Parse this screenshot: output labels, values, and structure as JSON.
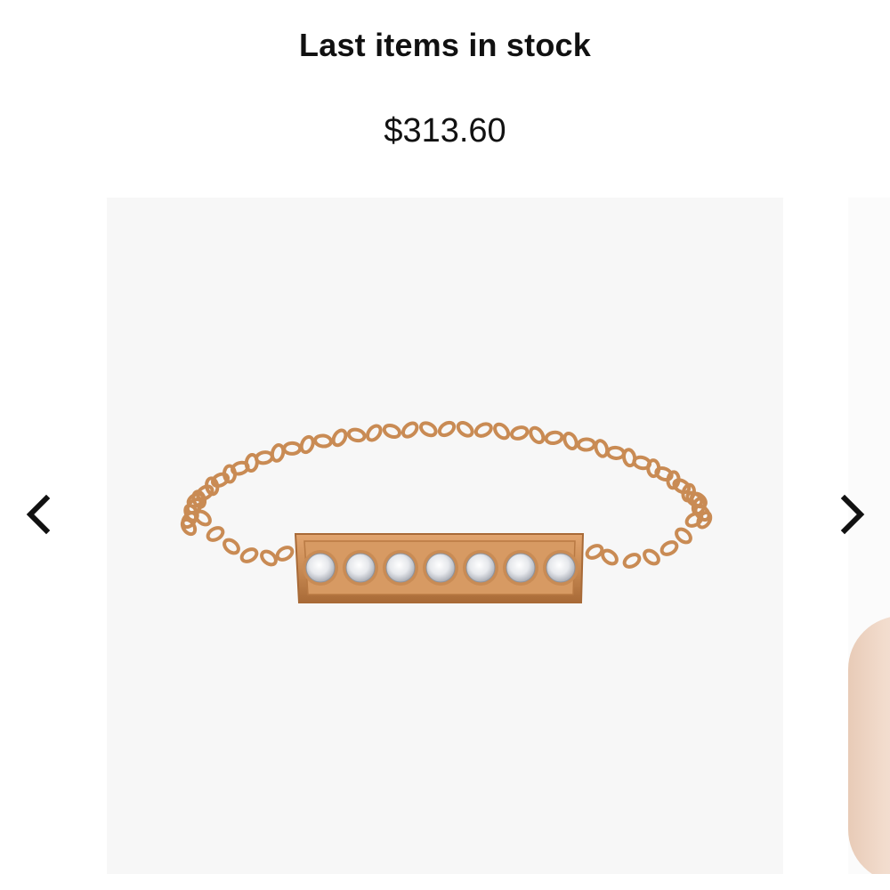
{
  "product": {
    "stock_status": "Last items in stock",
    "price": "$313.60"
  },
  "gallery": {
    "main_image": "gold-chain-ring-with-diamond-bar",
    "next_image": "ring-on-hand",
    "prev_icon": "chevron-left-icon",
    "next_icon": "chevron-right-icon"
  },
  "colors": {
    "gold": "#c98b54",
    "image_background": "#f7f7f7",
    "text": "#111111"
  }
}
